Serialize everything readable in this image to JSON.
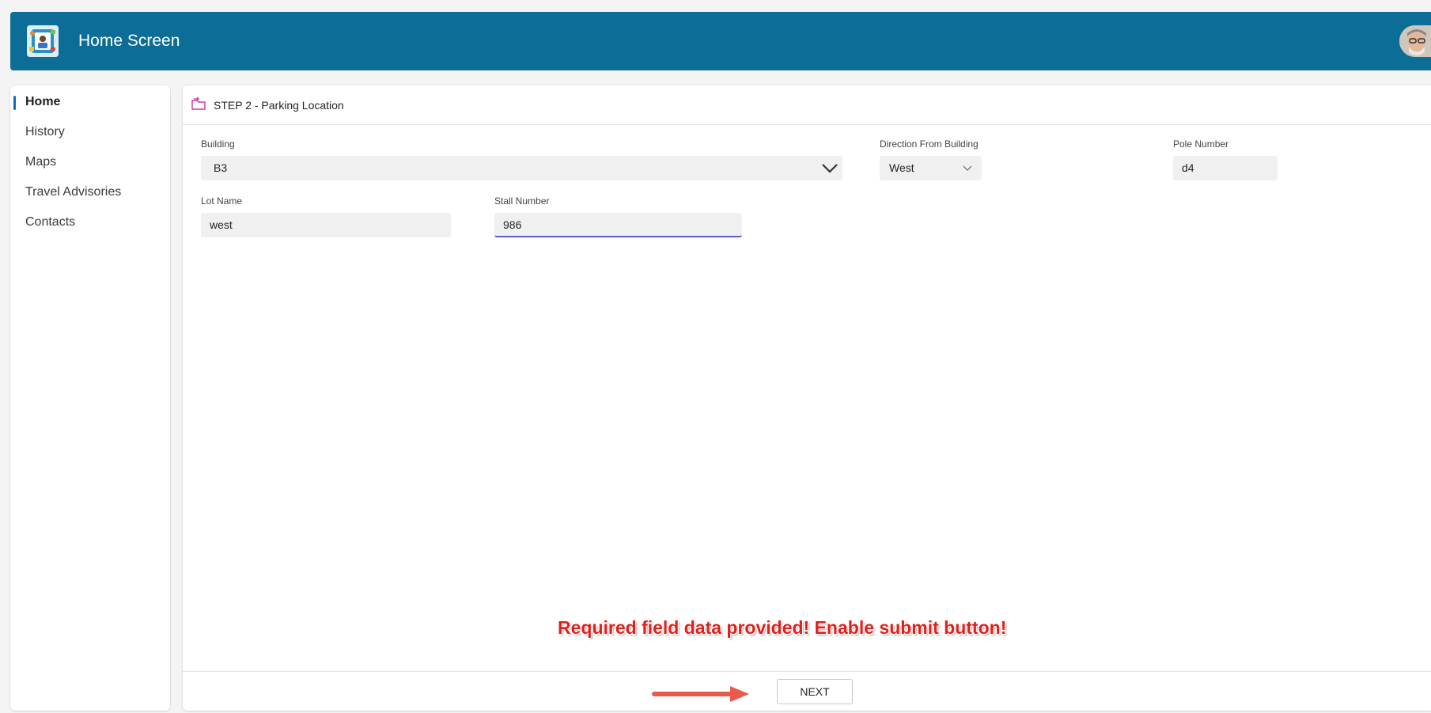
{
  "header": {
    "title": "Home Screen",
    "logo_icon": "app-logo-icon",
    "avatar_icon": "user-avatar-icon",
    "background_color": "#0c6e96"
  },
  "sidebar": {
    "items": [
      {
        "label": "Home",
        "active": true
      },
      {
        "label": "History",
        "active": false
      },
      {
        "label": "Maps",
        "active": false
      },
      {
        "label": "Travel Advisories",
        "active": false
      },
      {
        "label": "Contacts",
        "active": false
      }
    ],
    "indicator_color": "#0f6cbd"
  },
  "step": {
    "title": "STEP 2 - Parking Location",
    "icon": "parking-step-icon"
  },
  "form": {
    "building": {
      "label": "Building",
      "value": "B3"
    },
    "direction": {
      "label": "Direction From Building",
      "value": "West"
    },
    "pole_number": {
      "label": "Pole Number",
      "value": "d4"
    },
    "lot_name": {
      "label": "Lot Name",
      "value": "west"
    },
    "stall_number": {
      "label": "Stall Number",
      "value": "986"
    }
  },
  "annotation": {
    "text": "Required field data  provided! Enable submit button!",
    "color": "#e0201b"
  },
  "footer": {
    "next_label": "NEXT",
    "arrow_color": "#ea5a4a"
  }
}
